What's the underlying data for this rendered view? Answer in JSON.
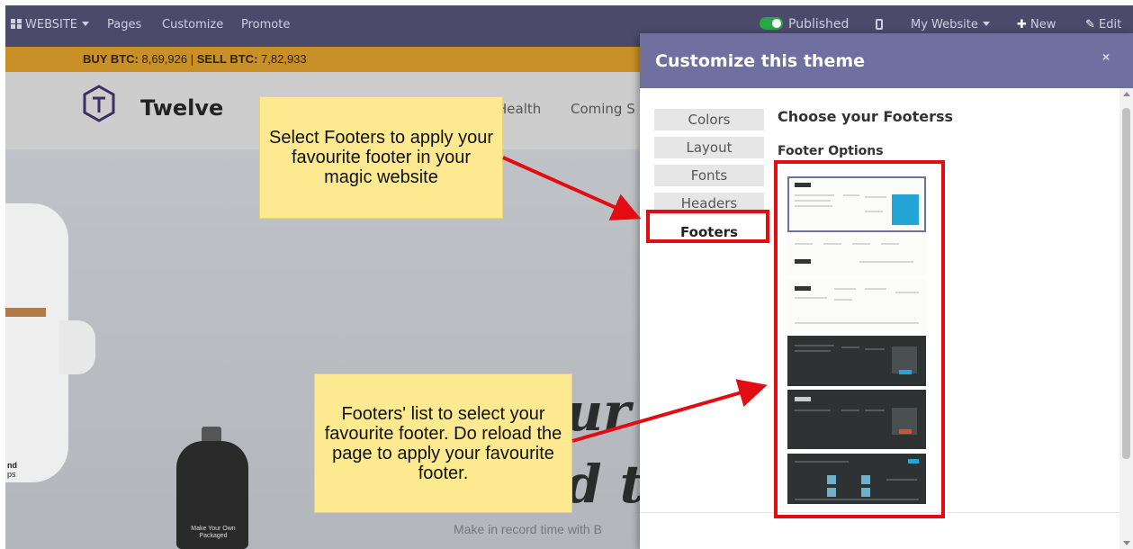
{
  "topbar": {
    "website_label": "WEBSITE",
    "menu": [
      "Pages",
      "Customize",
      "Promote"
    ],
    "published_label": "Published",
    "site_switcher": "My Website",
    "new_label": "New",
    "edit_label": "Edit"
  },
  "btc": {
    "buy_label": "BUY BTC:",
    "buy_value": "8,69,926",
    "separator": "|",
    "sell_label": "SELL BTC:",
    "sell_value": "7,82,933"
  },
  "site": {
    "brand": "Twelve",
    "nav": [
      "Health",
      "Coming S"
    ]
  },
  "hero": {
    "headline_1": "ur S",
    "headline_2": "d ti",
    "subtitle": "Make in record time with B",
    "bottle_label": "Make Your Own Packaged",
    "side_text_1": "nd",
    "side_text_2": "ps"
  },
  "callouts": {
    "top": "Select Footers to apply your favourite footer in your magic website",
    "bottom": "Footers' list to select your favourite footer. Do reload the page to apply your favourite footer."
  },
  "modal": {
    "title": "Customize this theme",
    "close_icon": "×",
    "tabs": [
      "Colors",
      "Layout",
      "Fonts",
      "Headers",
      "Footers"
    ],
    "active_tab": "Footers",
    "choose_title": "Choose your Footerss",
    "options_title": "Footer Options",
    "footer_options": [
      {
        "style": "light",
        "selected": true
      },
      {
        "style": "light",
        "selected": false
      },
      {
        "style": "light",
        "selected": false
      },
      {
        "style": "dark",
        "selected": false
      },
      {
        "style": "dark",
        "selected": false
      },
      {
        "style": "dark",
        "selected": false
      }
    ]
  },
  "colors": {
    "admin_bar": "#4b4a6b",
    "btc_bar": "#c9902a",
    "modal_header": "#6f6fa0",
    "highlight_red": "#e10d12",
    "callout_yellow": "#fde98f"
  }
}
